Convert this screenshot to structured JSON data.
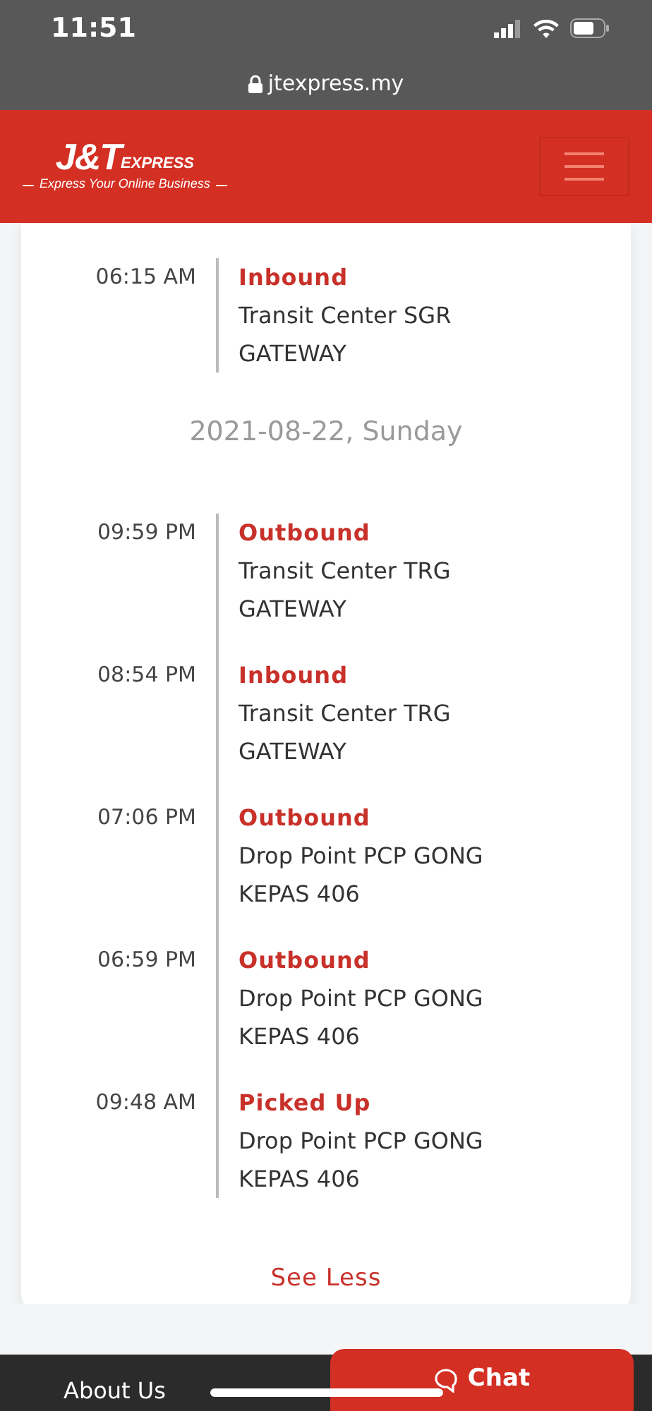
{
  "status_bar": {
    "time": "11:51"
  },
  "address_bar": {
    "url": "jtexpress.my"
  },
  "header": {
    "logo_mark": "J&T",
    "logo_word": "EXPRESS",
    "tagline": "Express Your Online Business"
  },
  "tracking": {
    "groups": [
      {
        "events": [
          {
            "time": "06:15 AM",
            "status": "Inbound",
            "location_lines": [
              "Transit Center SGR",
              "GATEWAY"
            ]
          }
        ]
      },
      {
        "date": "2021-08-22, Sunday",
        "events": [
          {
            "time": "09:59 PM",
            "status": "Outbound",
            "location_lines": [
              "Transit Center TRG",
              "GATEWAY"
            ]
          },
          {
            "time": "08:54 PM",
            "status": "Inbound",
            "location_lines": [
              "Transit Center TRG",
              "GATEWAY"
            ]
          },
          {
            "time": "07:06 PM",
            "status": "Outbound",
            "location_lines": [
              "Drop Point PCP GONG",
              "KEPAS 406"
            ]
          },
          {
            "time": "06:59 PM",
            "status": "Outbound",
            "location_lines": [
              "Drop Point PCP GONG",
              "KEPAS 406"
            ]
          },
          {
            "time": "09:48 AM",
            "status": "Picked Up",
            "location_lines": [
              "Drop Point PCP GONG",
              "KEPAS 406"
            ]
          }
        ]
      }
    ],
    "toggle": "See Less"
  },
  "footer": {
    "link": "About Us",
    "chat": "Chat"
  }
}
